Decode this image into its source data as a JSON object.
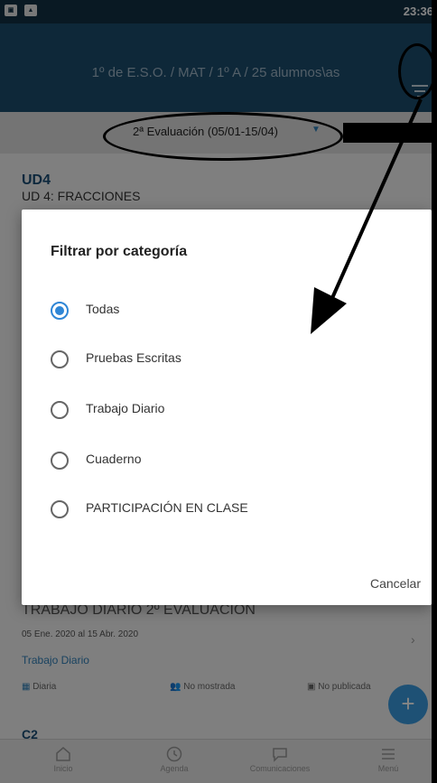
{
  "status_bar": {
    "time": "23:36"
  },
  "app_bar": {
    "title": "1º de E.S.O. / MAT / 1º A / 25 alumnos\\as"
  },
  "evaluation": {
    "label": "2ª Evaluación (05/01-15/04)"
  },
  "unit_card": {
    "code": "UD4",
    "name": "UD 4: FRACCIONES"
  },
  "task_card": {
    "title": "TRABAJO DIARIO 2º EVALUACION",
    "dates": "05 Ene. 2020 al 15 Abr. 2020",
    "category": "Trabajo Diario",
    "meta": {
      "frequency": "Diaria",
      "visibility": "No mostrada",
      "publication": "No publicada"
    }
  },
  "next_card": {
    "code": "C2"
  },
  "bottom_nav": [
    {
      "label": "Inicio",
      "icon": "home-icon"
    },
    {
      "label": "Agenda",
      "icon": "clock-icon"
    },
    {
      "label": "Comunicaciones",
      "icon": "chat-icon"
    },
    {
      "label": "Menú",
      "icon": "menu-icon"
    }
  ],
  "dialog": {
    "title": "Filtrar por categoría",
    "options": [
      {
        "label": "Todas",
        "selected": true
      },
      {
        "label": "Pruebas Escritas",
        "selected": false
      },
      {
        "label": "Trabajo Diario",
        "selected": false
      },
      {
        "label": "Cuaderno",
        "selected": false
      },
      {
        "label": "PARTICIPACIÓN EN CLASE",
        "selected": false
      }
    ],
    "cancel_label": "Cancelar"
  },
  "colors": {
    "app_bar": "#1b4e6e",
    "accent": "#2f86d6",
    "fab": "#3a9be0",
    "status_bar": "#123043"
  }
}
